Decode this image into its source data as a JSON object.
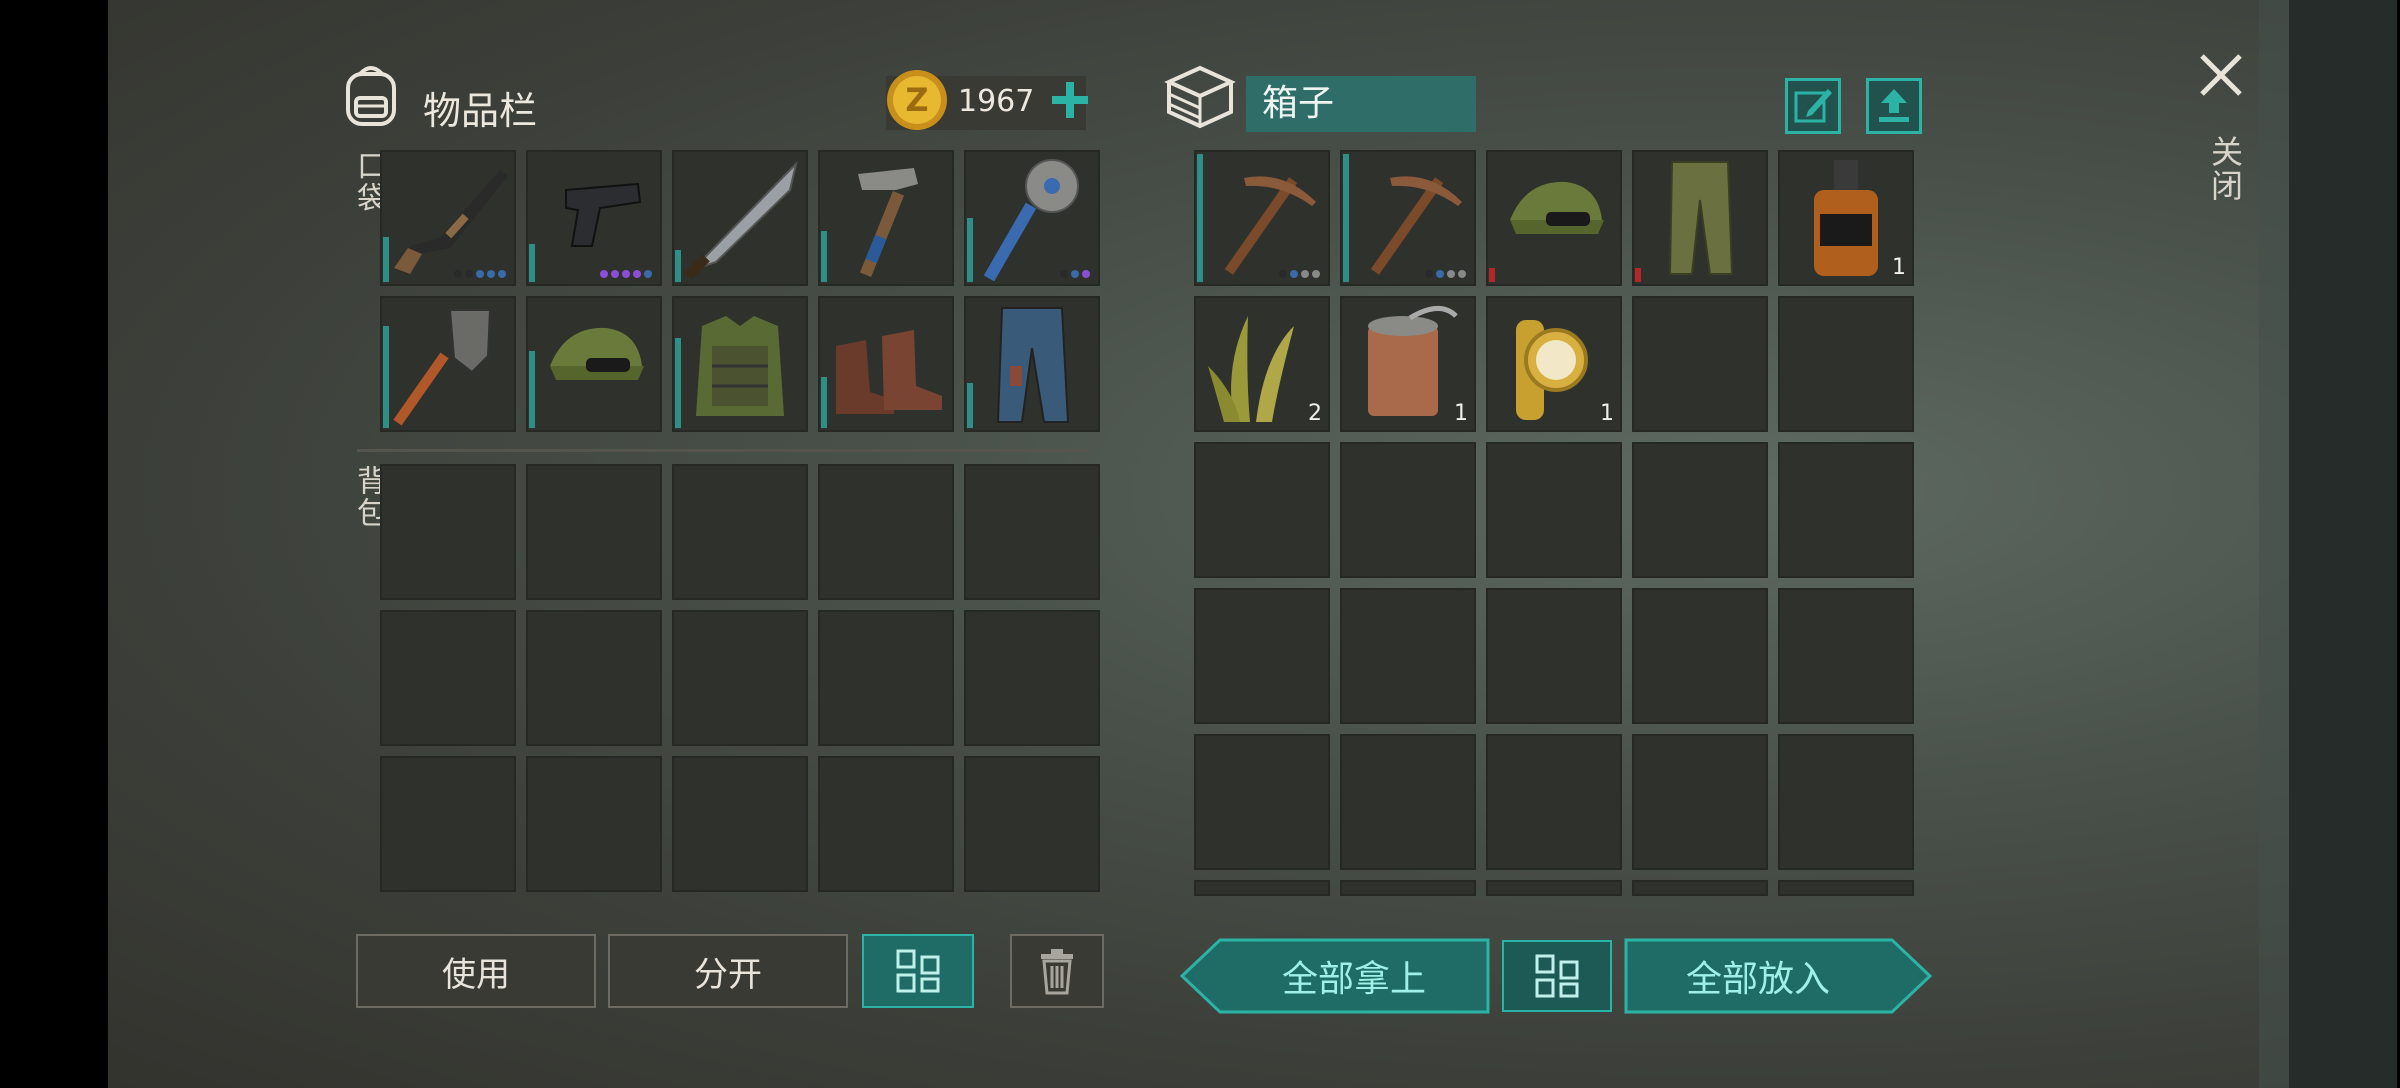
{
  "inventory": {
    "title": "物品栏",
    "coins": "1967",
    "pocket_label": "口袋",
    "backpack_label": "背包",
    "pocket_slots": [
      {
        "icon": "shotgun-icon",
        "dots": [
          "#2a2a2a",
          "#2a2a2a",
          "#3a6aa8",
          "#3a6aa8",
          "#3a6aa8"
        ],
        "durability": 0.35
      },
      {
        "icon": "pistol-icon",
        "dots": [
          "#8a4fd6",
          "#8a4fd6",
          "#8a4fd6",
          "#8a4fd6",
          "#3a6aa8"
        ],
        "durability": 0.3
      },
      {
        "icon": "machete-icon",
        "dots": [],
        "durability": 0.25
      },
      {
        "icon": "hammer-icon",
        "dots": [],
        "durability": 0.4
      },
      {
        "icon": "saw-club-icon",
        "dots": [
          "#2a2a2a",
          "#3a6aa8",
          "#8a4fd6"
        ],
        "durability": 0.5
      },
      {
        "icon": "shovel-icon",
        "dots": [],
        "durability": 0.8
      },
      {
        "icon": "camo-cap-icon",
        "dots": [],
        "durability": 0.6
      },
      {
        "icon": "vest-icon",
        "dots": [],
        "durability": 0.7
      },
      {
        "icon": "boots-icon",
        "dots": [],
        "durability": 0.4
      },
      {
        "icon": "pants-icon",
        "dots": [],
        "durability": 0.35
      }
    ]
  },
  "box": {
    "title": "箱子",
    "slots": [
      {
        "icon": "pickaxe-icon",
        "dots": [
          "#2a2a2a",
          "#3a6aa8",
          "#888",
          "#888"
        ],
        "durability": 1.0,
        "qty": ""
      },
      {
        "icon": "pickaxe-icon",
        "dots": [
          "#2a2a2a",
          "#3a6aa8",
          "#888",
          "#888"
        ],
        "durability": 1.0,
        "qty": ""
      },
      {
        "icon": "camo-cap-icon",
        "dots": [],
        "durability": 0.12,
        "red": true,
        "qty": ""
      },
      {
        "icon": "camo-pants-icon",
        "dots": [],
        "durability": 0.05,
        "red": true,
        "qty": ""
      },
      {
        "icon": "whiskey-icon",
        "dots": [],
        "durability": 0,
        "qty": "1"
      },
      {
        "icon": "plant-fiber-icon",
        "dots": [],
        "durability": 0,
        "qty": "2"
      },
      {
        "icon": "canned-food-icon",
        "dots": [],
        "durability": 0,
        "qty": "1"
      },
      {
        "icon": "gold-watch-icon",
        "dots": [],
        "durability": 0,
        "qty": "1"
      }
    ]
  },
  "buttons": {
    "use": "使用",
    "split": "分开",
    "take_all": "全部拿上",
    "put_all": "全部放入"
  },
  "close_label": "关闭",
  "colors": {
    "accent": "#2bb3a6",
    "accent_dark": "#1f6c66",
    "durability": "#2e8f86",
    "broken": "#b3262a",
    "coin": "#e0b22c"
  }
}
